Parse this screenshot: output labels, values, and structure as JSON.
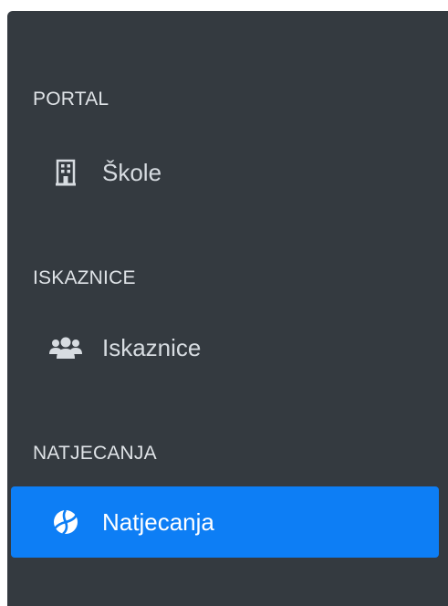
{
  "colors": {
    "sidebar_bg": "#343a40",
    "text": "#d7dce1",
    "header_text": "#dfe3e7",
    "active_bg": "#0d7ef5",
    "active_text": "#ffffff"
  },
  "sidebar": {
    "sections": [
      {
        "header": "PORTAL",
        "item": {
          "label": "Škole",
          "icon": "building-icon",
          "active": false
        }
      },
      {
        "header": "ISKAZNICE",
        "item": {
          "label": "Iskaznice",
          "icon": "users-icon",
          "active": false
        }
      },
      {
        "header": "NATJECANJA",
        "item": {
          "label": "Natjecanja",
          "icon": "volleyball-icon",
          "active": true
        }
      }
    ]
  }
}
